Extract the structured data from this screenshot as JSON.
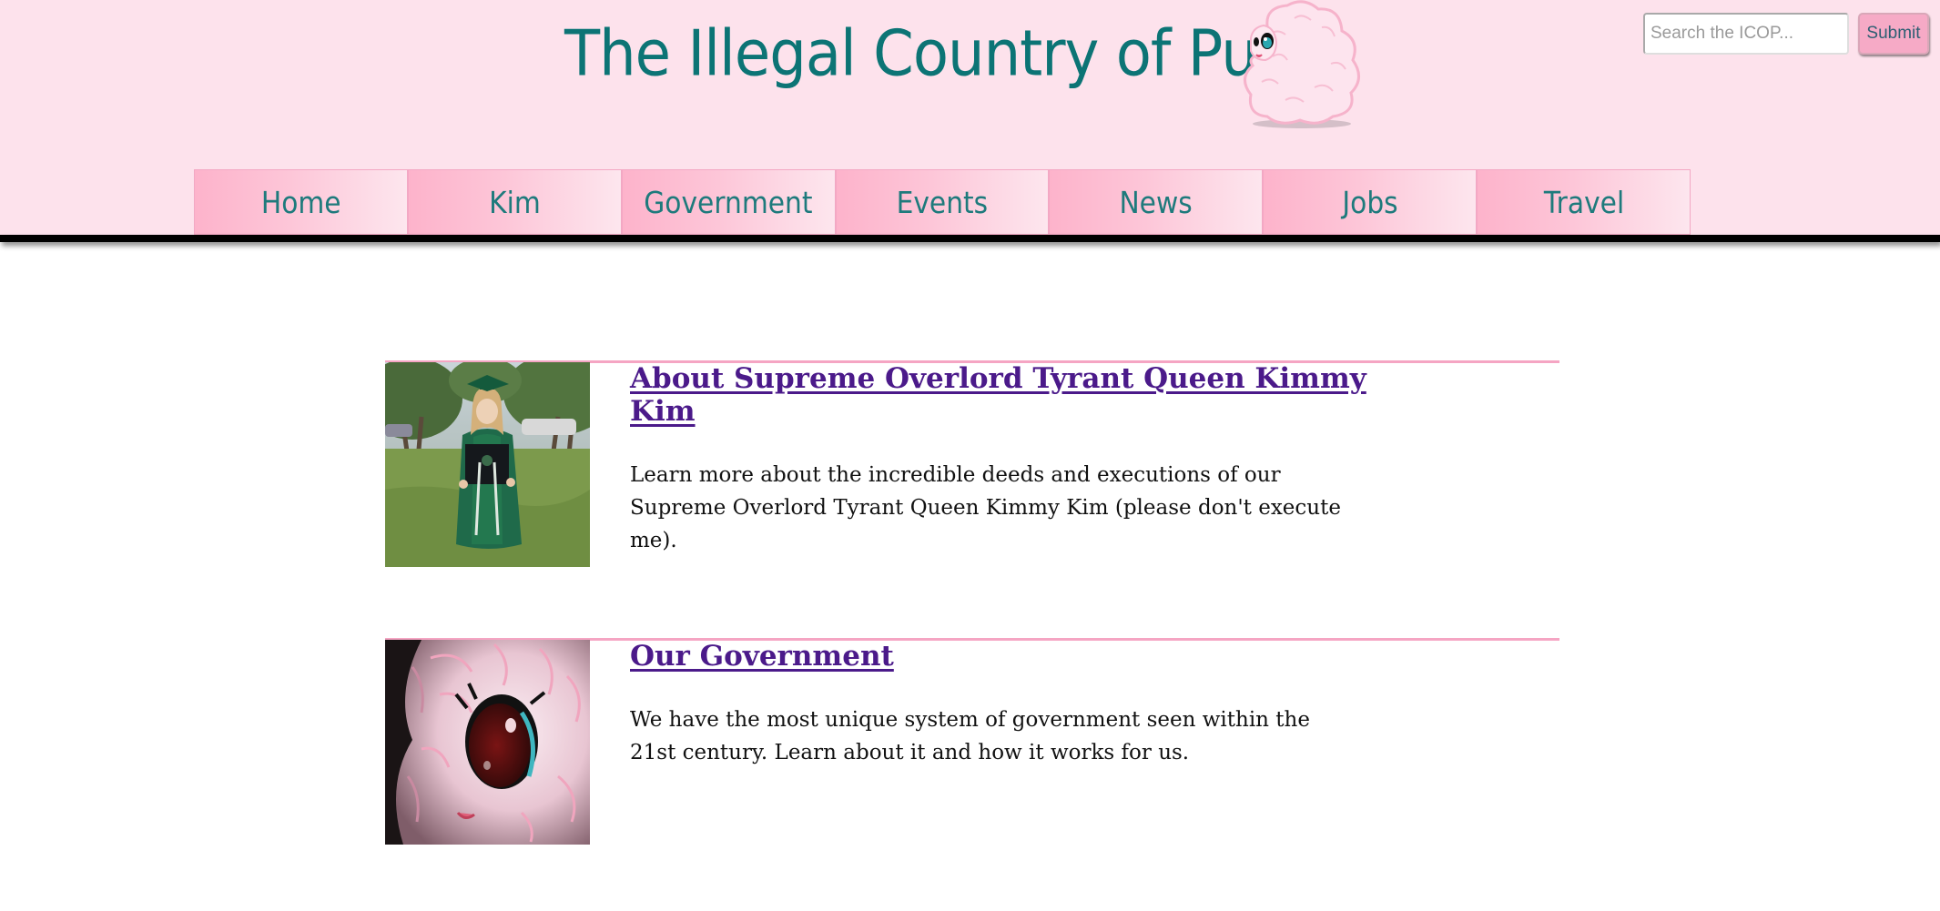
{
  "header": {
    "site_title": "The Illegal Country of Puff",
    "mascot_icon": "fluffy-pony-mascot",
    "background_color": "#fde2ec",
    "title_color": "#0c7475"
  },
  "search": {
    "placeholder": "Search the ICOP...",
    "value": "",
    "submit_label": "Submit"
  },
  "nav": {
    "items": [
      {
        "label": "Home"
      },
      {
        "label": "Kim"
      },
      {
        "label": "Government"
      },
      {
        "label": "Events"
      },
      {
        "label": "News"
      },
      {
        "label": "Jobs"
      },
      {
        "label": "Travel"
      }
    ]
  },
  "articles": [
    {
      "title": "About Supreme Overlord Tyrant Queen Kimmy Kim",
      "text": "Learn more about the incredible deeds and executions of our Supreme Overlord Tyrant Queen Kimmy Kim (please don't execute me).",
      "image_icon": "graduation-photo"
    },
    {
      "title": "Our Government",
      "text": "We have the most unique system of government seen within the 21st century. Learn about it and how it works for us.",
      "image_icon": "pony-eye-closeup"
    }
  ],
  "colors": {
    "accent_pink": "#f5a5c3",
    "link_purple": "#4b1a8a",
    "nav_text": "#1e7a7c"
  }
}
